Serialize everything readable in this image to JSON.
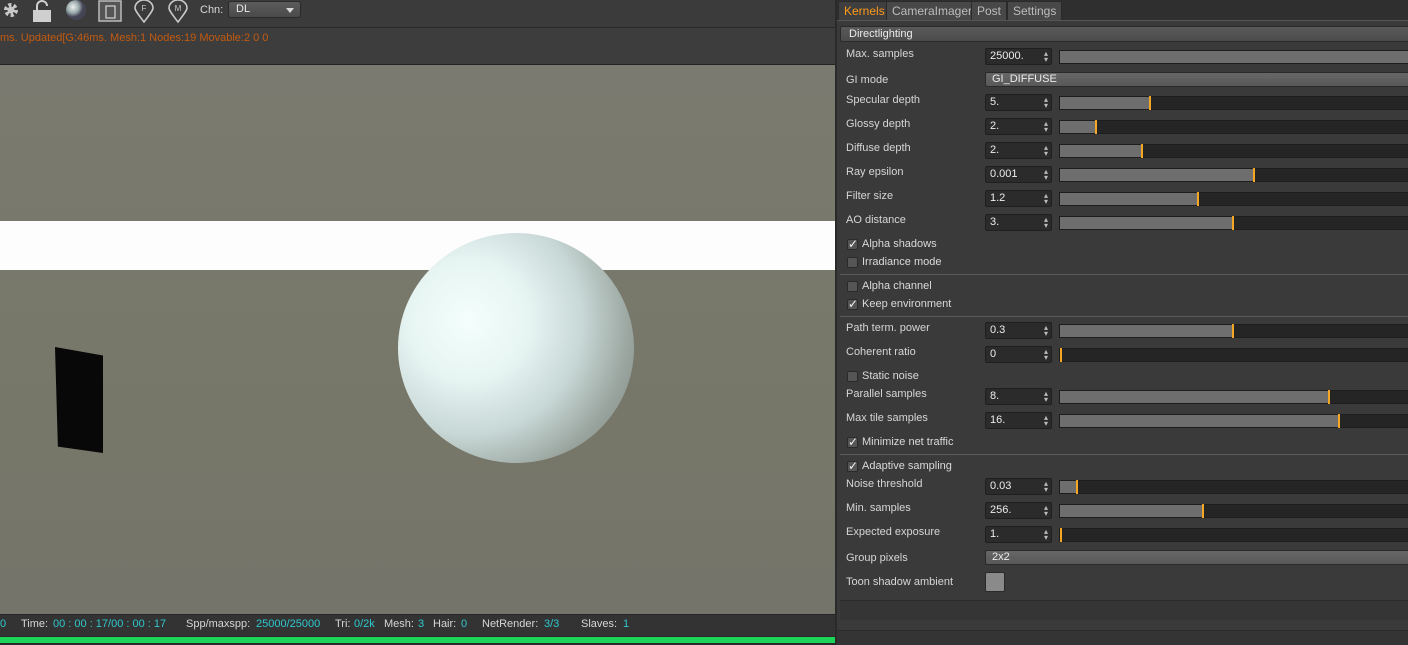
{
  "toolbar": {
    "icons": [
      "gear-icon",
      "lock-icon",
      "material-ball-icon",
      "clay-mode-icon",
      "focus-pin-icon",
      "material-pin-icon"
    ],
    "channel_label": "Chn:",
    "channel_value": "DL"
  },
  "viewport": {
    "status_message": "ms. Updated[G:46ms. Mesh:1 Nodes:19 Movable:2 0 0"
  },
  "stats": {
    "left_value": "0",
    "time_label": "Time:",
    "time_value": "00 : 00 : 17/00 : 00 : 17",
    "spp_label": "Spp/maxspp:",
    "spp_value": "25000/25000",
    "tri_label": "Tri:",
    "tri_value": "0/2k",
    "mesh_label": "Mesh:",
    "mesh_value": "3",
    "hair_label": "Hair:",
    "hair_value": "0",
    "netrender_label": "NetRender:",
    "netrender_value": "3/3",
    "slaves_label": "Slaves:",
    "slaves_value": "1",
    "progress_fraction": 1.0,
    "progress_color": "#1dd45a"
  },
  "tabs": [
    {
      "label": "Kernels",
      "active": true
    },
    {
      "label": "CameraImager",
      "active": false
    },
    {
      "label": "Post",
      "active": false
    },
    {
      "label": "Settings",
      "active": false
    }
  ],
  "kernel": {
    "section_title": "Directlighting",
    "max_samples": {
      "label": "Max. samples",
      "value": "25000.",
      "fraction": 1.0
    },
    "gi_mode": {
      "label": "GI mode",
      "value": "GI_DIFFUSE"
    },
    "specular_depth": {
      "label": "Specular depth",
      "value": "5.",
      "fraction": 0.254
    },
    "glossy_depth": {
      "label": "Glossy depth",
      "value": "2.",
      "fraction": 0.1
    },
    "diffuse_depth": {
      "label": "Diffuse depth",
      "value": "2.",
      "fraction": 0.232
    },
    "ray_epsilon": {
      "label": "Ray epsilon",
      "value": "0.001",
      "fraction": 0.551
    },
    "filter_size": {
      "label": "Filter size",
      "value": "1.2",
      "fraction": 0.392
    },
    "ao_distance": {
      "label": "AO distance",
      "value": "3.",
      "fraction": 0.49
    },
    "alpha_shadows": {
      "label": "Alpha shadows",
      "checked": true
    },
    "irradiance_mode": {
      "label": "Irradiance mode",
      "checked": false
    },
    "alpha_channel": {
      "label": "Alpha channel",
      "checked": false
    },
    "keep_environment": {
      "label": "Keep environment",
      "checked": true
    },
    "path_term_power": {
      "label": "Path term. power",
      "value": "0.3",
      "fraction": 0.49
    },
    "coherent_ratio": {
      "label": "Coherent ratio",
      "value": "0",
      "fraction": 0.0
    },
    "static_noise": {
      "label": "Static noise",
      "checked": false
    },
    "parallel_samples": {
      "label": "Parallel samples",
      "value": "8.",
      "fraction": 0.765
    },
    "max_tile_samples": {
      "label": "Max tile samples",
      "value": "16.",
      "fraction": 0.793
    },
    "minimize_net_traffic": {
      "label": "Minimize net traffic",
      "checked": true
    },
    "adaptive_sampling": {
      "label": "Adaptive sampling",
      "checked": true
    },
    "noise_threshold": {
      "label": "Noise threshold",
      "value": "0.03",
      "fraction": 0.045
    },
    "min_samples": {
      "label": "Min. samples",
      "value": "256.",
      "fraction": 0.407
    },
    "expected_exposure": {
      "label": "Expected exposure",
      "value": "1.",
      "fraction": 0.0
    },
    "group_pixels": {
      "label": "Group pixels",
      "value": "2x2"
    },
    "toon_shadow_ambient": {
      "label": "Toon shadow ambient",
      "color": "#8a8a8a"
    }
  },
  "colors": {
    "accent_orange": "#f5a623",
    "active_tab_text": "#ff9a1a",
    "stat_value_cyan": "#2ec9cf",
    "status_message_orange": "#c25a10"
  }
}
